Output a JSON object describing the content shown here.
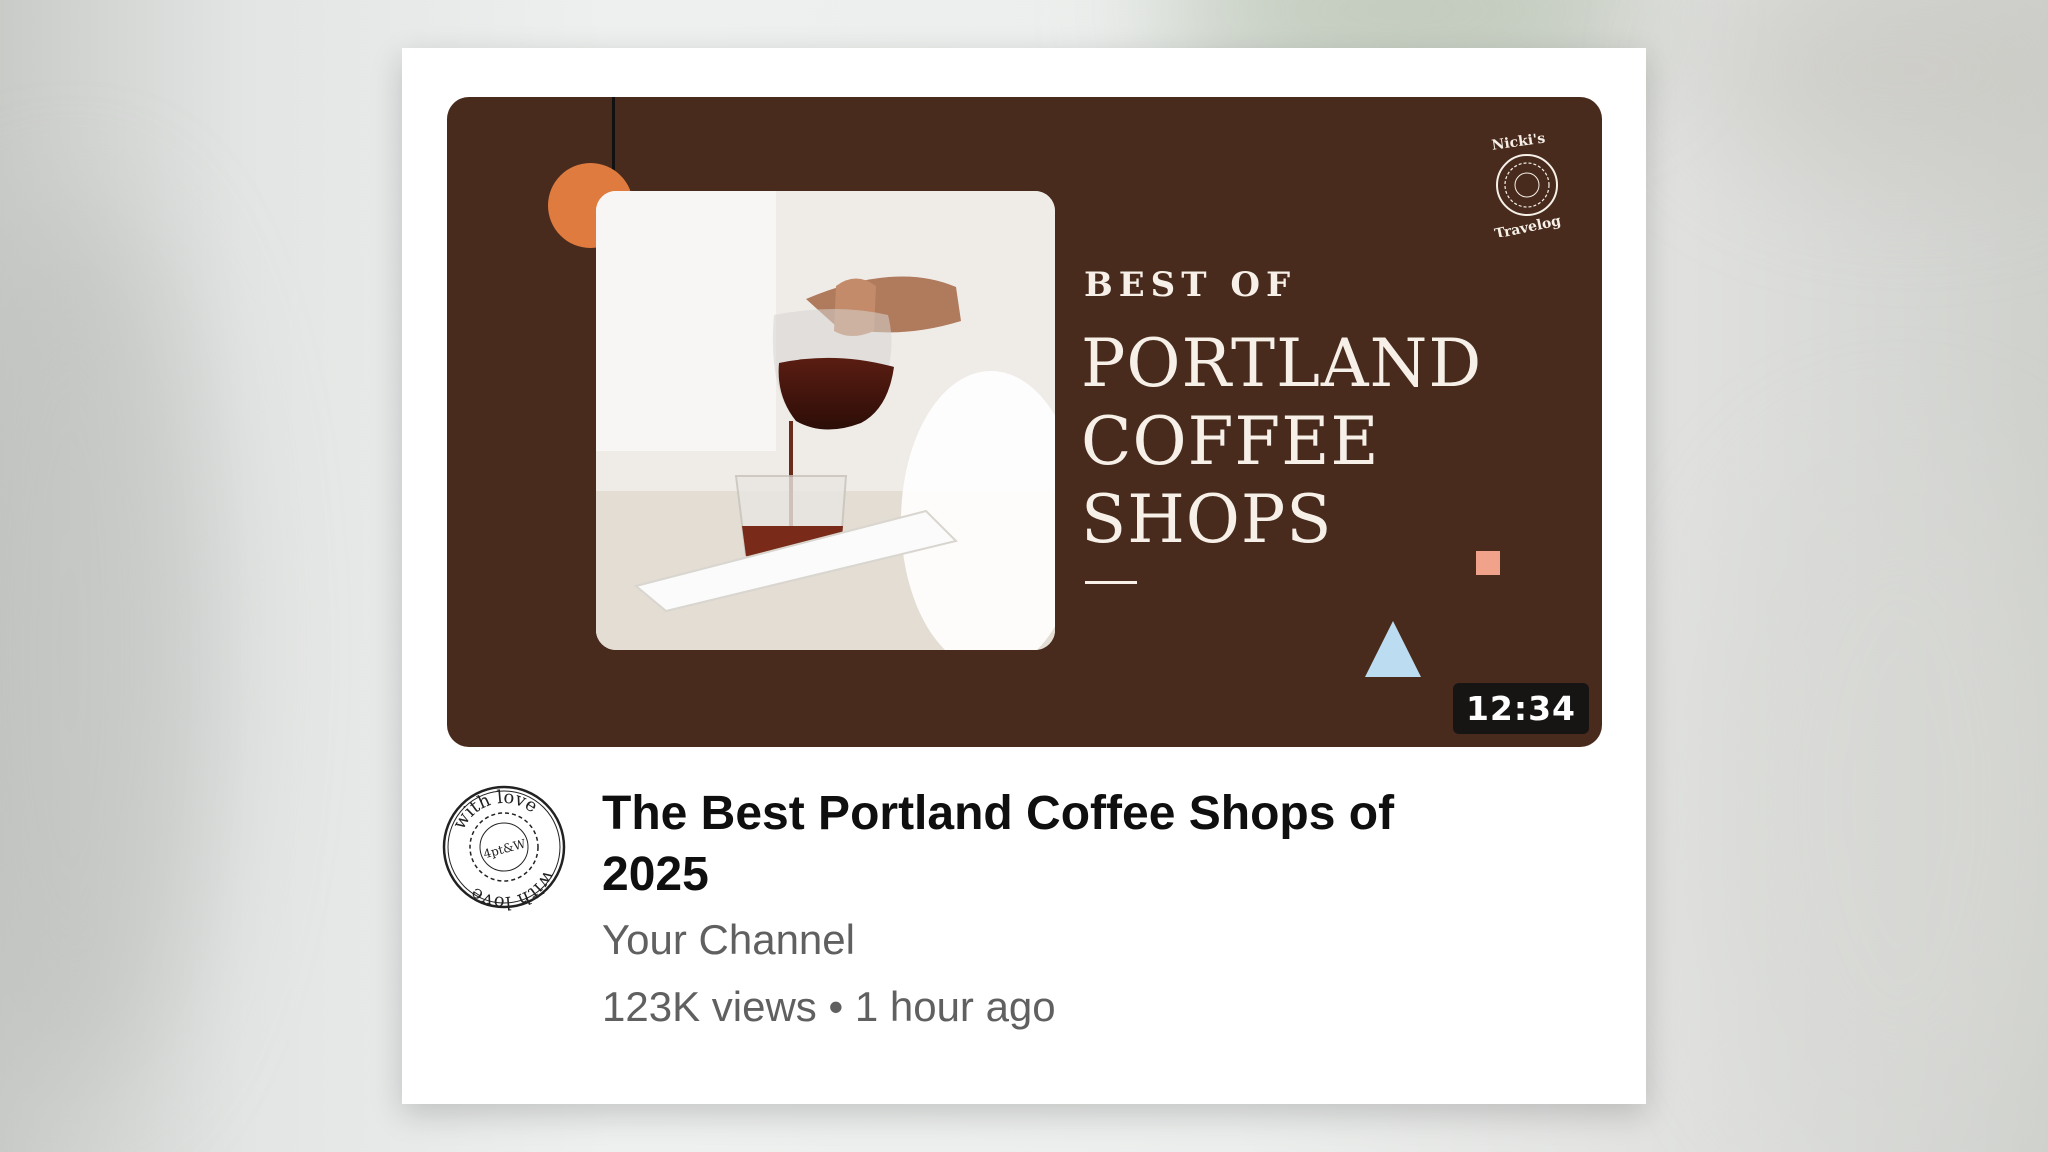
{
  "video": {
    "thumbnail": {
      "kicker": "BEST OF",
      "title_lines": [
        "PORTLAND",
        "COFFEE",
        "SHOPS"
      ],
      "stamp_top": "Nicki's",
      "stamp_bottom": "Travelog",
      "duration": "12:34"
    },
    "title": "The Best Portland Coffee Shops of 2025",
    "channel": "Your Channel",
    "meta": "123K views • 1 hour ago",
    "avatar_stamp": {
      "outer": "with love",
      "inner": "4pt & W"
    }
  },
  "colors": {
    "thumbnail_bg": "#482b1d",
    "accent_orange": "#e07b3f",
    "accent_pink": "#f0a28a",
    "accent_blue": "#bcdcf2",
    "title_text": "#0f0f0f",
    "secondary_text": "#606060"
  }
}
